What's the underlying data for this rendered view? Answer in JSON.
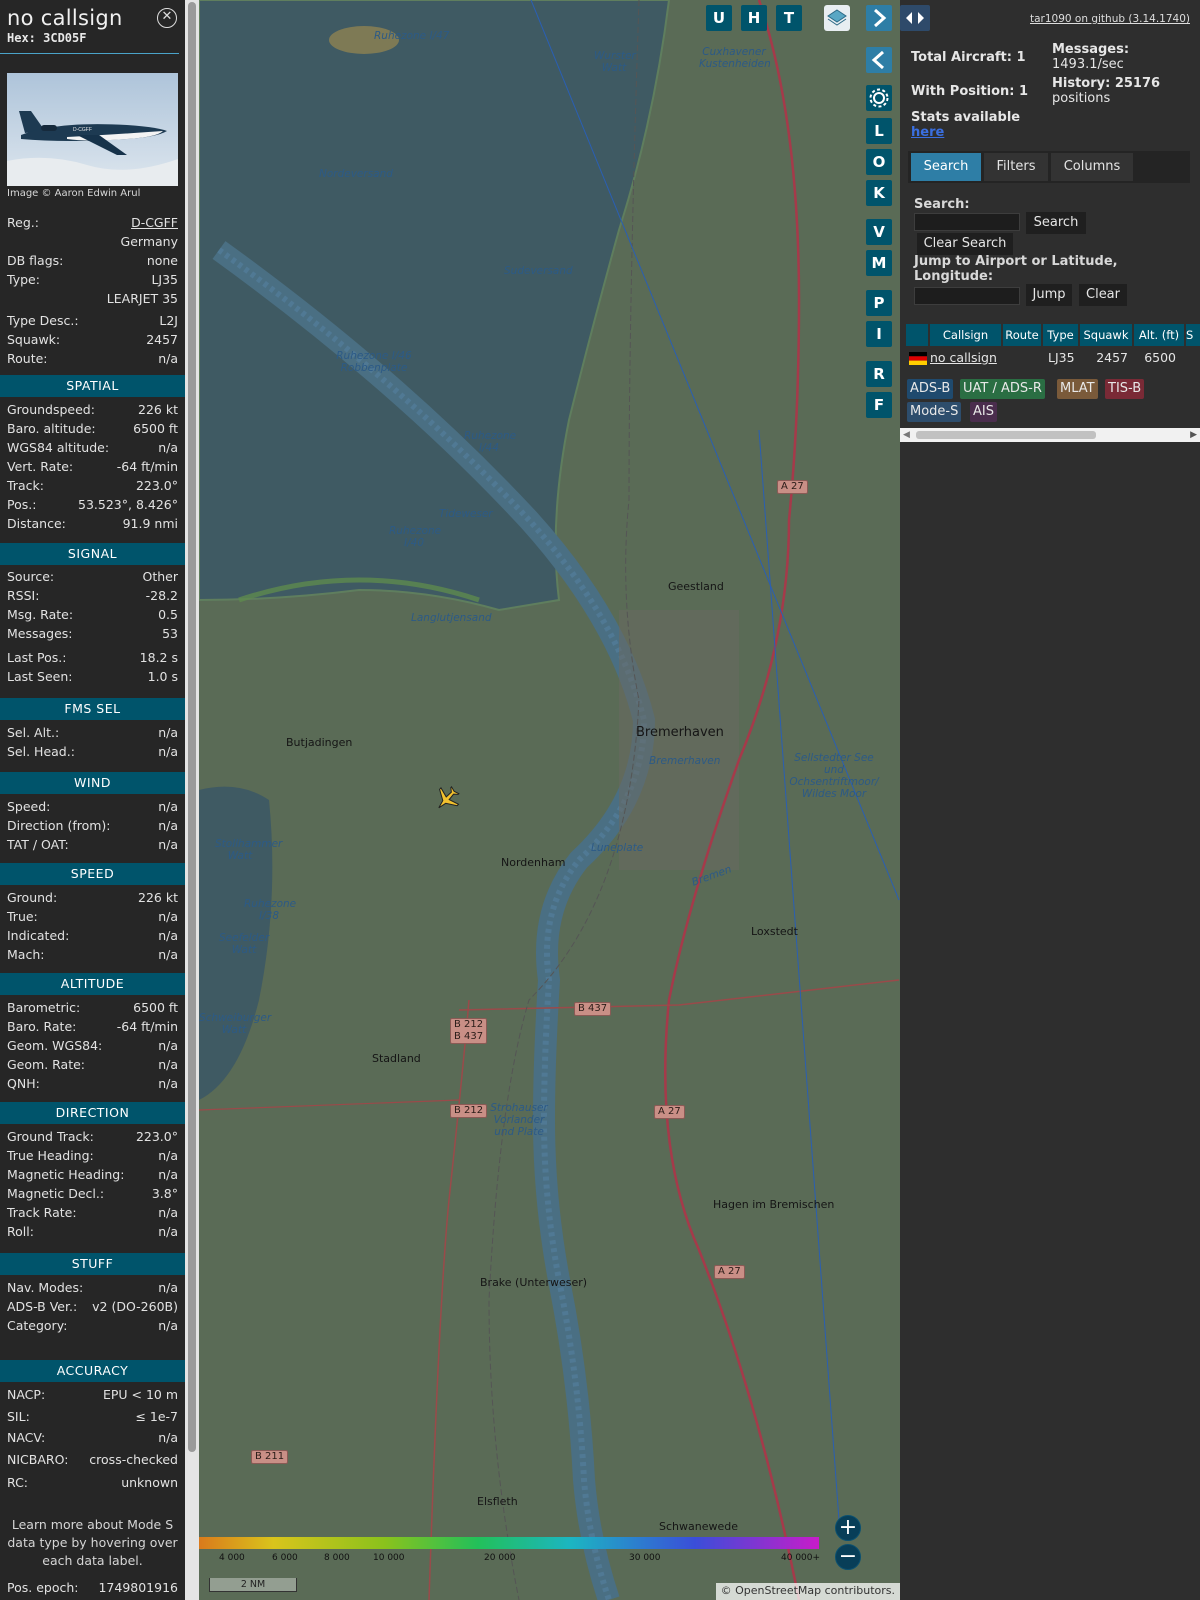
{
  "aircraft": {
    "callsign": "no callsign",
    "hex": "Hex: 3CD05F",
    "photo_credit": "Image © Aaron Edwin Arul",
    "photo_livery": "D-CGFF"
  },
  "details": {
    "reg_label": "Reg.:",
    "reg": "D-CGFF",
    "country": "Germany",
    "dbflags_label": "DB flags:",
    "dbflags": "none",
    "type_label": "Type:",
    "type": "LJ35",
    "type_name": "LEARJET 35",
    "typedesc_label": "Type Desc.:",
    "typedesc": "L2J",
    "squawk_label": "Squawk:",
    "squawk": "2457",
    "route_label": "Route:",
    "route": "n/a"
  },
  "sections": {
    "spatial": {
      "title": "SPATIAL",
      "rows": [
        {
          "k": "Groundspeed:",
          "v": "226 kt"
        },
        {
          "k": "Baro. altitude:",
          "v": "6500 ft"
        },
        {
          "k": "WGS84 altitude:",
          "v": "n/a"
        },
        {
          "k": "Vert. Rate:",
          "v": "-64 ft/min"
        },
        {
          "k": "Track:",
          "v": "223.0°"
        },
        {
          "k": "Pos.:",
          "v": "53.523°, 8.426°"
        },
        {
          "k": "Distance:",
          "v": "91.9 nmi"
        }
      ]
    },
    "signal": {
      "title": "SIGNAL",
      "rows": [
        {
          "k": "Source:",
          "v": "Other"
        },
        {
          "k": "RSSI:",
          "v": "-28.2"
        },
        {
          "k": "Msg. Rate:",
          "v": "0.5"
        },
        {
          "k": "Messages:",
          "v": "53"
        },
        {
          "k": "Last Pos.:",
          "v": "18.2 s"
        },
        {
          "k": "Last Seen:",
          "v": "1.0 s"
        }
      ]
    },
    "fms": {
      "title": "FMS SEL",
      "rows": [
        {
          "k": "Sel. Alt.:",
          "v": "n/a"
        },
        {
          "k": "Sel. Head.:",
          "v": "n/a"
        }
      ]
    },
    "wind": {
      "title": "WIND",
      "rows": [
        {
          "k": "Speed:",
          "v": "n/a"
        },
        {
          "k": "Direction (from):",
          "v": "n/a"
        },
        {
          "k": "TAT / OAT:",
          "v": "n/a"
        }
      ]
    },
    "speed": {
      "title": "SPEED",
      "rows": [
        {
          "k": "Ground:",
          "v": "226 kt"
        },
        {
          "k": "True:",
          "v": "n/a"
        },
        {
          "k": "Indicated:",
          "v": "n/a"
        },
        {
          "k": "Mach:",
          "v": "n/a"
        }
      ]
    },
    "altitude": {
      "title": "ALTITUDE",
      "rows": [
        {
          "k": "Barometric:",
          "v": "6500 ft"
        },
        {
          "k": "Baro. Rate:",
          "v": "-64 ft/min"
        },
        {
          "k": "Geom. WGS84:",
          "v": "n/a"
        },
        {
          "k": "Geom. Rate:",
          "v": "n/a"
        },
        {
          "k": "QNH:",
          "v": "n/a"
        }
      ]
    },
    "direction": {
      "title": "DIRECTION",
      "rows": [
        {
          "k": "Ground Track:",
          "v": "223.0°"
        },
        {
          "k": "True Heading:",
          "v": "n/a"
        },
        {
          "k": "Magnetic Heading:",
          "v": "n/a"
        },
        {
          "k": "Magnetic Decl.:",
          "v": "3.8°"
        },
        {
          "k": "Track Rate:",
          "v": "n/a"
        },
        {
          "k": "Roll:",
          "v": "n/a"
        }
      ]
    },
    "stuff": {
      "title": "STUFF",
      "rows": [
        {
          "k": "Nav. Modes:",
          "v": "n/a"
        },
        {
          "k": "ADS-B Ver.:",
          "v": "v2 (DO-260B)"
        },
        {
          "k": "Category:",
          "v": "n/a"
        }
      ]
    },
    "accuracy": {
      "title": "ACCURACY",
      "rows": [
        {
          "k": "NACP:",
          "v": "EPU < 10 m"
        },
        {
          "k": "SIL:",
          "v": "≤ 1e-7"
        },
        {
          "k": "NACV:",
          "v": "n/a"
        },
        {
          "k": "NICBARO:",
          "v": "cross-checked"
        },
        {
          "k": "RC:",
          "v": "unknown"
        }
      ]
    }
  },
  "note": "Learn more about Mode S data type by hovering over each data label.",
  "pos_epoch": {
    "k": "Pos. epoch:",
    "v": "1749801916"
  },
  "map": {
    "controls": [
      "U",
      "H",
      "T"
    ],
    "side_buttons": [
      "L",
      "O",
      "K",
      "V",
      "M",
      "P",
      "I",
      "R",
      "F"
    ],
    "place_labels": [
      "Geestland",
      "Bremerhaven",
      "Butjadingen",
      "Nordenham",
      "Loxstedt",
      "Stadland",
      "Hagen im Bremischen",
      "Brake (Unterweser)",
      "Elsfleth",
      "Schwanewede"
    ],
    "water_labels": [
      "Ruhezone I/47",
      "Nordeversand",
      "Wurster Watt",
      "Sudeversand",
      "Ruhezone I/46 Robbenplate",
      "Ruhezone I/44",
      "Tideweser",
      "Ruhezone I/40",
      "Langlutjensand",
      "Luneplate",
      "Stollhammer Watt",
      "Ruhezone I/38",
      "Seefelder Watt",
      "Schweiburger Watt",
      "Strohauser Vorlander und Plate",
      "Cuxhavener Kustenheiden",
      "Sellstedter See und Ochsentriftmoor/ Wildes Moor",
      "Bremerhaven",
      "Bremen"
    ],
    "road_shields": [
      "A 27",
      "B 437",
      "B 212",
      "B 437",
      "B 212",
      "A 27",
      "A 27",
      "B 211"
    ],
    "altitude_ticks": [
      "4 000",
      "6 000",
      "8 000",
      "10 000",
      "20 000",
      "30 000",
      "40 000+"
    ],
    "scale": "2 NM",
    "attribution": "© OpenStreetMap contributors."
  },
  "sidebar": {
    "github": "tar1090 on github (3.14.1740)",
    "total_aircraft": "Total Aircraft: 1",
    "with_position": "With Position: 1",
    "messages_label": "Messages:",
    "messages_value": "1493.1/sec",
    "history_label": "History: 25176",
    "history_value": "positions",
    "stats_text": "Stats available",
    "stats_link": "here",
    "tabs": [
      "Search",
      "Filters",
      "Columns"
    ],
    "search_label": "Search:",
    "search_button": "Search",
    "clear_search": "Clear Search",
    "jump_label": "Jump to Airport or Latitude, Longitude:",
    "jump_button": "Jump",
    "clear_button": "Clear",
    "table_headers": [
      "Callsign",
      "Route",
      "Type",
      "Squawk",
      "Alt. (ft)",
      "S"
    ],
    "table_row": {
      "callsign": "no callsign",
      "route": "",
      "type": "LJ35",
      "squawk": "2457",
      "alt": "6500"
    },
    "sources": [
      {
        "label": "ADS-B",
        "color": "#1f4a6e"
      },
      {
        "label": "UAT / ADS-R",
        "color": "#2a6e43"
      },
      {
        "label": "MLAT",
        "color": "#7a5a3a"
      },
      {
        "label": "TIS-B",
        "color": "#7a2a36"
      },
      {
        "label": "Mode-S",
        "color": "#2d4d6c"
      },
      {
        "label": "AIS",
        "color": "#4a2d4d"
      }
    ]
  },
  "colors": {
    "section": "#00546b",
    "accent": "#2e7ea6",
    "panel": "#262626"
  }
}
